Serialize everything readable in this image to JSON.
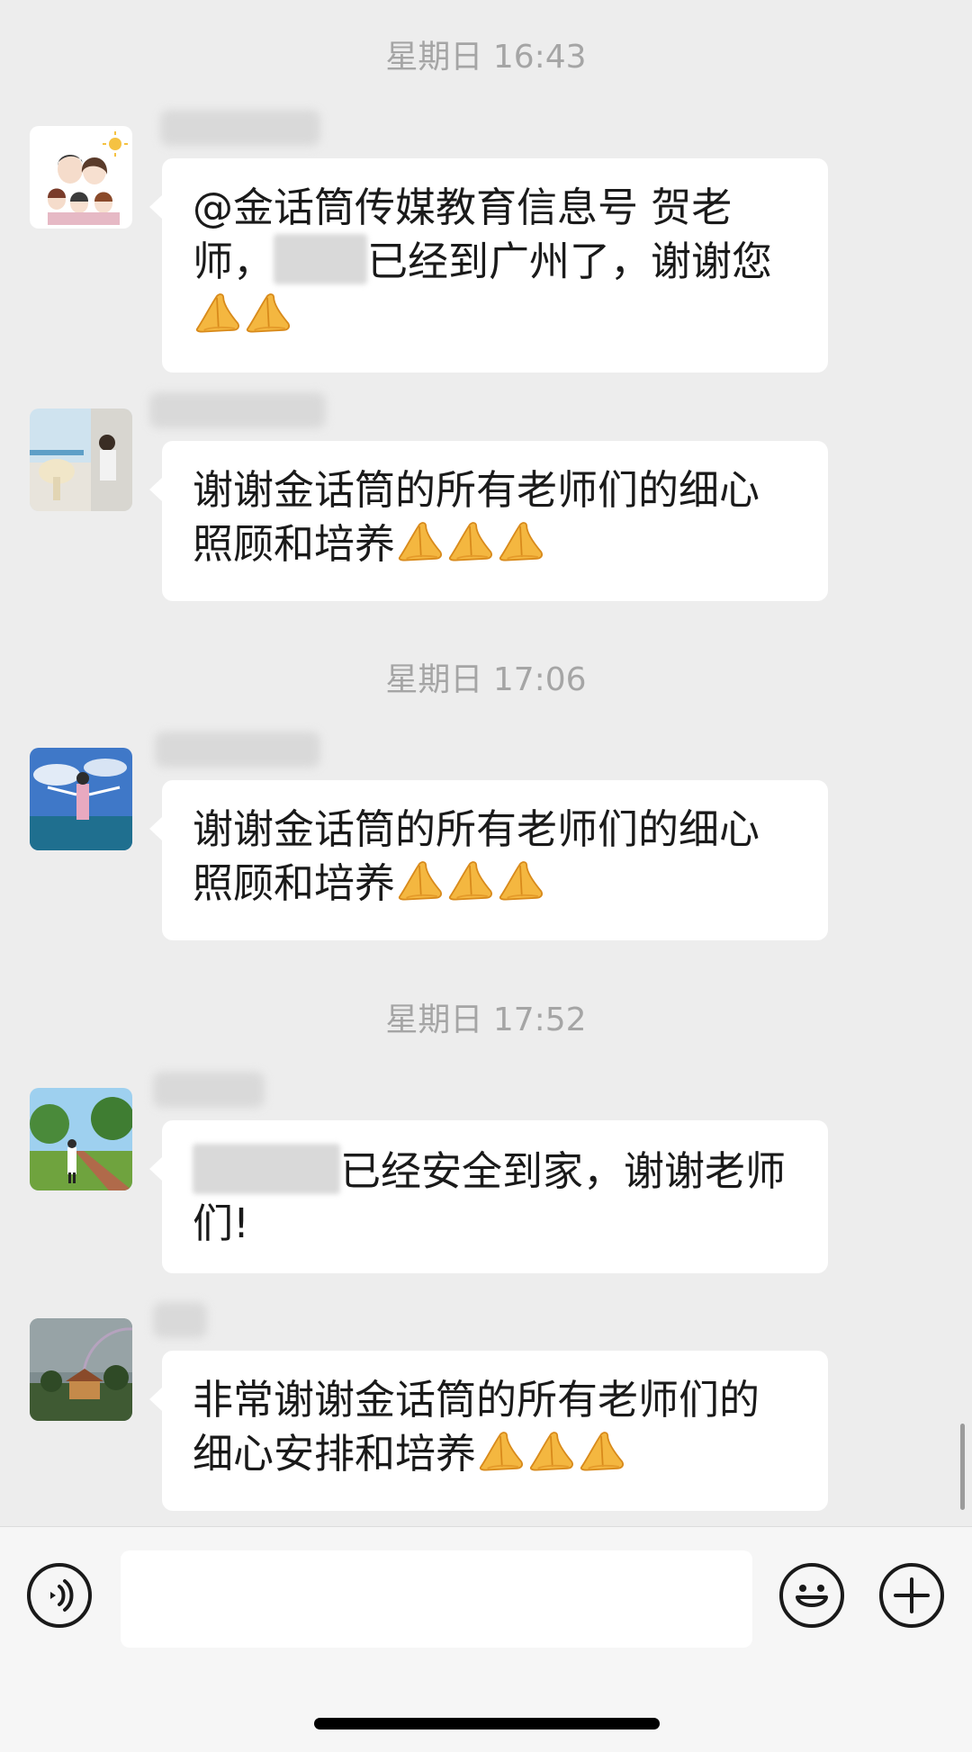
{
  "timestamps": [
    "星期日 16:43",
    "星期日 17:06",
    "星期日 17:52"
  ],
  "messages": [
    {
      "text_before": "@金话筒传媒教育信息号 贺老师，",
      "text_after": "已经到广州了，谢谢您",
      "hands": 2
    },
    {
      "text": "谢谢金话筒的所有老师们的细心照顾和培养",
      "hands": 3
    },
    {
      "text": "谢谢金话筒的所有老师们的细心照顾和培养",
      "hands": 3
    },
    {
      "text_after": "已经安全到家，谢谢老师们!",
      "hands": 0
    },
    {
      "text": "非常谢谢金话筒的所有老师们的细心安排和培养",
      "hands": 3
    }
  ],
  "input": {
    "value": ""
  },
  "colors": {
    "background": "#ededed",
    "bubble": "#ffffff",
    "timestamp": "#a5a5a5",
    "text": "#1a1a1a",
    "emoji": "#f2b33d"
  },
  "icons": {
    "voice": "voice-icon",
    "emoji": "emoji-icon",
    "plus": "plus-icon",
    "pray": "folded-hands-emoji"
  }
}
